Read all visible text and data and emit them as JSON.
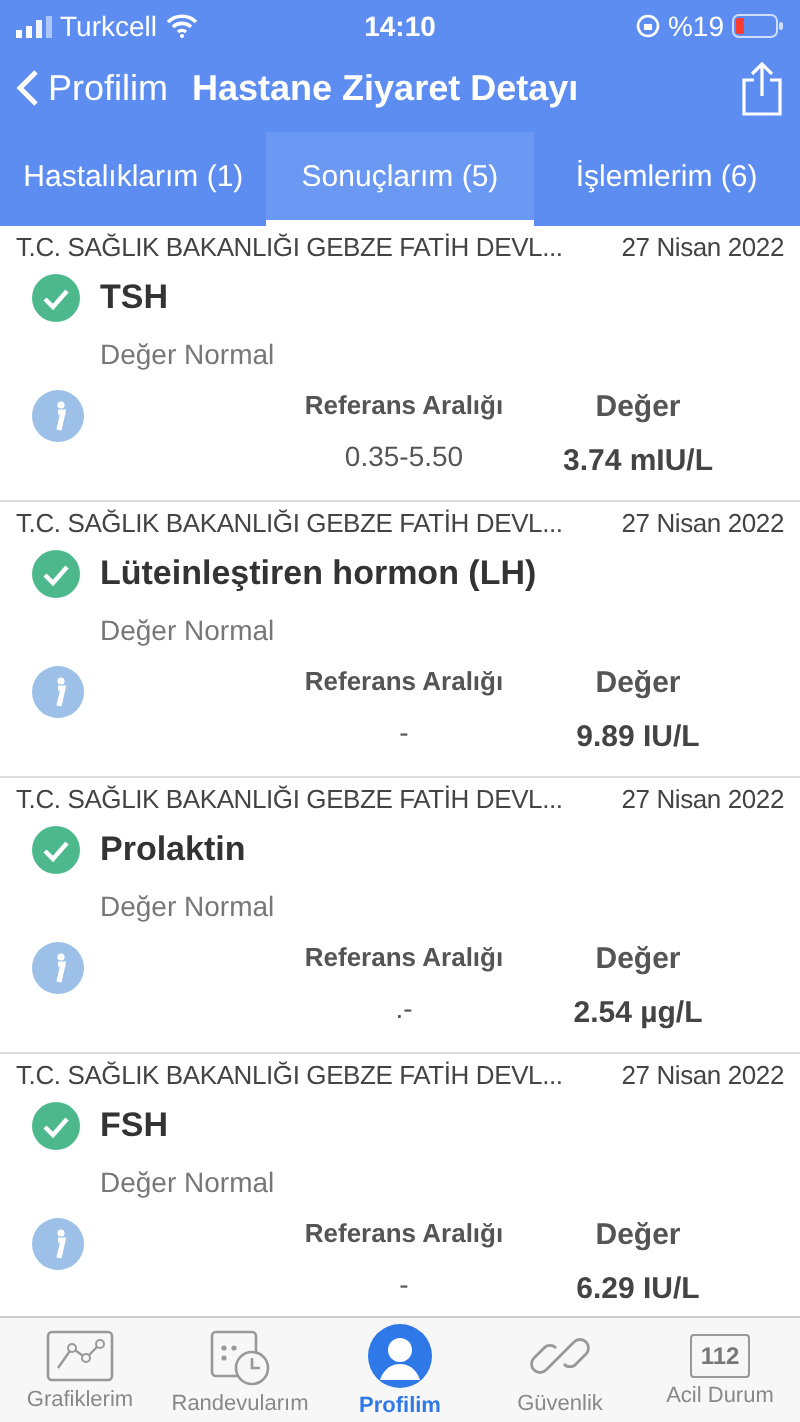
{
  "status_bar": {
    "carrier": "Turkcell",
    "time": "14:10",
    "battery": "%19"
  },
  "nav": {
    "back": "Profilim",
    "title": "Hastane Ziyaret Detayı"
  },
  "tabs": [
    {
      "label": "Hastalıklarım (1)",
      "selected": false
    },
    {
      "label": "Sonuçlarım (5)",
      "selected": true
    },
    {
      "label": "İşlemlerim (6)",
      "selected": false
    }
  ],
  "results": [
    {
      "hospital": "T.C. SAĞLIK BAKANLIĞI GEBZE FATİH DEVL...",
      "date": "27 Nisan 2022",
      "name": "TSH",
      "status": "Değer Normal",
      "range_label": "Referans Aralığı",
      "value_label": "Değer",
      "range": "0.35-5.50",
      "value": "3.74 mIU/L"
    },
    {
      "hospital": "T.C. SAĞLIK BAKANLIĞI GEBZE FATİH DEVL...",
      "date": "27 Nisan 2022",
      "name": "Lüteinleştiren hormon (LH)",
      "status": "Değer Normal",
      "range_label": "Referans Aralığı",
      "value_label": "Değer",
      "range": "-",
      "value": "9.89 IU/L"
    },
    {
      "hospital": "T.C. SAĞLIK BAKANLIĞI GEBZE FATİH DEVL...",
      "date": "27 Nisan 2022",
      "name": "Prolaktin",
      "status": "Değer Normal",
      "range_label": "Referans Aralığı",
      "value_label": "Değer",
      "range": ".-",
      "value": "2.54 µg/L"
    },
    {
      "hospital": "T.C. SAĞLIK BAKANLIĞI GEBZE FATİH DEVL...",
      "date": "27 Nisan 2022",
      "name": "FSH",
      "status": "Değer Normal",
      "range_label": "Referans Aralığı",
      "value_label": "Değer",
      "range": "-",
      "value": "6.29 IU/L"
    }
  ],
  "tab_bar": [
    {
      "kind": "chart",
      "label": "Grafiklerim",
      "selected": false
    },
    {
      "kind": "calendar",
      "label": "Randevularım",
      "selected": false
    },
    {
      "kind": "profile",
      "label": "Profilim",
      "selected": true
    },
    {
      "kind": "link",
      "label": "Güvenlik",
      "selected": false
    },
    {
      "kind": "emergency",
      "label": "Acil Durum",
      "icon_text": "112",
      "selected": false
    }
  ]
}
